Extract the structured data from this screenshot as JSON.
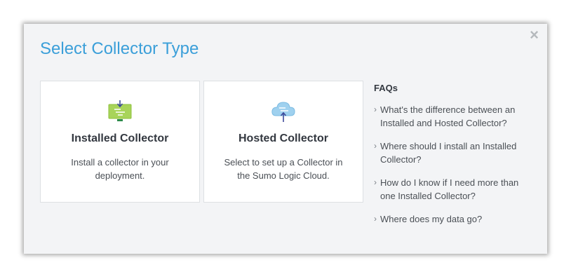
{
  "modal": {
    "title": "Select Collector Type",
    "close_glyph": "×"
  },
  "cards": [
    {
      "icon": "computer-download-icon",
      "title": "Installed Collector",
      "description": "Install a collector in your deployment."
    },
    {
      "icon": "cloud-upload-icon",
      "title": "Hosted Collector",
      "description": "Select to set up a Collector in the Sumo Logic Cloud."
    }
  ],
  "faq": {
    "heading": "FAQs",
    "items": [
      "What's the difference between an Installed and Hosted Collector?",
      "Where should I install an Installed Collector?",
      "How do I know if I need more than one Installed Collector?",
      "Where does my data go?"
    ],
    "chevron_glyph": "›"
  },
  "colors": {
    "accent": "#3b9fd9",
    "modal_bg": "#f3f4f6",
    "card_bg": "#ffffff",
    "installed_icon": "#a8d45a",
    "hosted_icon": "#9fd1ef"
  }
}
